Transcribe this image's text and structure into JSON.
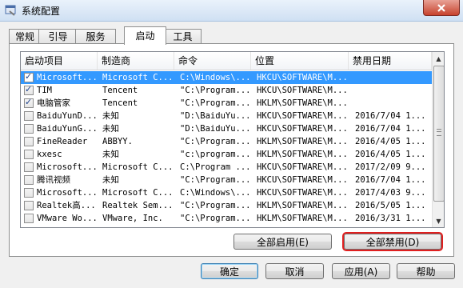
{
  "window": {
    "title": "系统配置",
    "app_icon": "msconfig-icon",
    "close_icon": "close-icon"
  },
  "tabs": [
    {
      "label": "常规"
    },
    {
      "label": "引导"
    },
    {
      "label": "服务"
    },
    {
      "label": "启动",
      "active": true
    },
    {
      "label": "工具"
    }
  ],
  "table": {
    "headers": [
      "启动项目",
      "制造商",
      "命令",
      "位置",
      "禁用日期"
    ],
    "rows": [
      {
        "checked": true,
        "selected": true,
        "item": "Microsoft...",
        "maker": "Microsoft C...",
        "command": "C:\\Windows\\...",
        "location": "HKCU\\SOFTWARE\\M...",
        "date": ""
      },
      {
        "checked": true,
        "selected": false,
        "item": "TIM",
        "maker": "Tencent",
        "command": "\"C:\\Program...",
        "location": "HKCU\\SOFTWARE\\M...",
        "date": ""
      },
      {
        "checked": true,
        "selected": false,
        "item": "电脑管家",
        "maker": "Tencent",
        "command": "\"C:\\Program...",
        "location": "HKLM\\SOFTWARE\\M...",
        "date": ""
      },
      {
        "checked": false,
        "selected": false,
        "item": "BaiduYunD...",
        "maker": "未知",
        "command": "\"D:\\BaiduYu...",
        "location": "HKCU\\SOFTWARE\\M...",
        "date": "2016/7/04 1..."
      },
      {
        "checked": false,
        "selected": false,
        "item": "BaiduYunG...",
        "maker": "未知",
        "command": "\"D:\\BaiduYu...",
        "location": "HKCU\\SOFTWARE\\M...",
        "date": "2016/7/04 1..."
      },
      {
        "checked": false,
        "selected": false,
        "item": "FineReader",
        "maker": "ABBYY.",
        "command": "\"C:\\Program...",
        "location": "HKLM\\SOFTWARE\\M...",
        "date": "2016/4/05 1..."
      },
      {
        "checked": false,
        "selected": false,
        "item": "kxesc",
        "maker": "未知",
        "command": "\"c:\\program...",
        "location": "HKLM\\SOFTWARE\\M...",
        "date": "2016/4/05 1..."
      },
      {
        "checked": false,
        "selected": false,
        "item": "Microsoft...",
        "maker": "Microsoft C...",
        "command": "C:\\Program ...",
        "location": "HKCU\\SOFTWARE\\M...",
        "date": "2017/2/09 9..."
      },
      {
        "checked": false,
        "selected": false,
        "item": "腾讯视频",
        "maker": "未知",
        "command": "\"C:\\Program...",
        "location": "HKCU\\SOFTWARE\\M...",
        "date": "2016/7/04 1..."
      },
      {
        "checked": false,
        "selected": false,
        "item": "Microsoft...",
        "maker": "Microsoft C...",
        "command": "C:\\Windows\\...",
        "location": "HKCU\\SOFTWARE\\M...",
        "date": "2017/4/03 9..."
      },
      {
        "checked": false,
        "selected": false,
        "item": "Realtek高...",
        "maker": "Realtek Sem...",
        "command": "\"C:\\Program...",
        "location": "HKLM\\SOFTWARE\\M...",
        "date": "2016/5/05 1..."
      },
      {
        "checked": false,
        "selected": false,
        "item": "VMware Wo...",
        "maker": "VMware, Inc.",
        "command": "\"C:\\Program...",
        "location": "HKLM\\SOFTWARE\\M...",
        "date": "2016/3/31 1..."
      }
    ]
  },
  "buttons": {
    "enable_all": "全部启用(E)",
    "disable_all": "全部禁用(D)",
    "ok": "确定",
    "cancel": "取消",
    "apply": "应用(A)",
    "help": "帮助"
  },
  "scrollbar": {
    "up_icon": "scroll-up-arrow-icon",
    "down_icon": "scroll-down-arrow-icon"
  }
}
